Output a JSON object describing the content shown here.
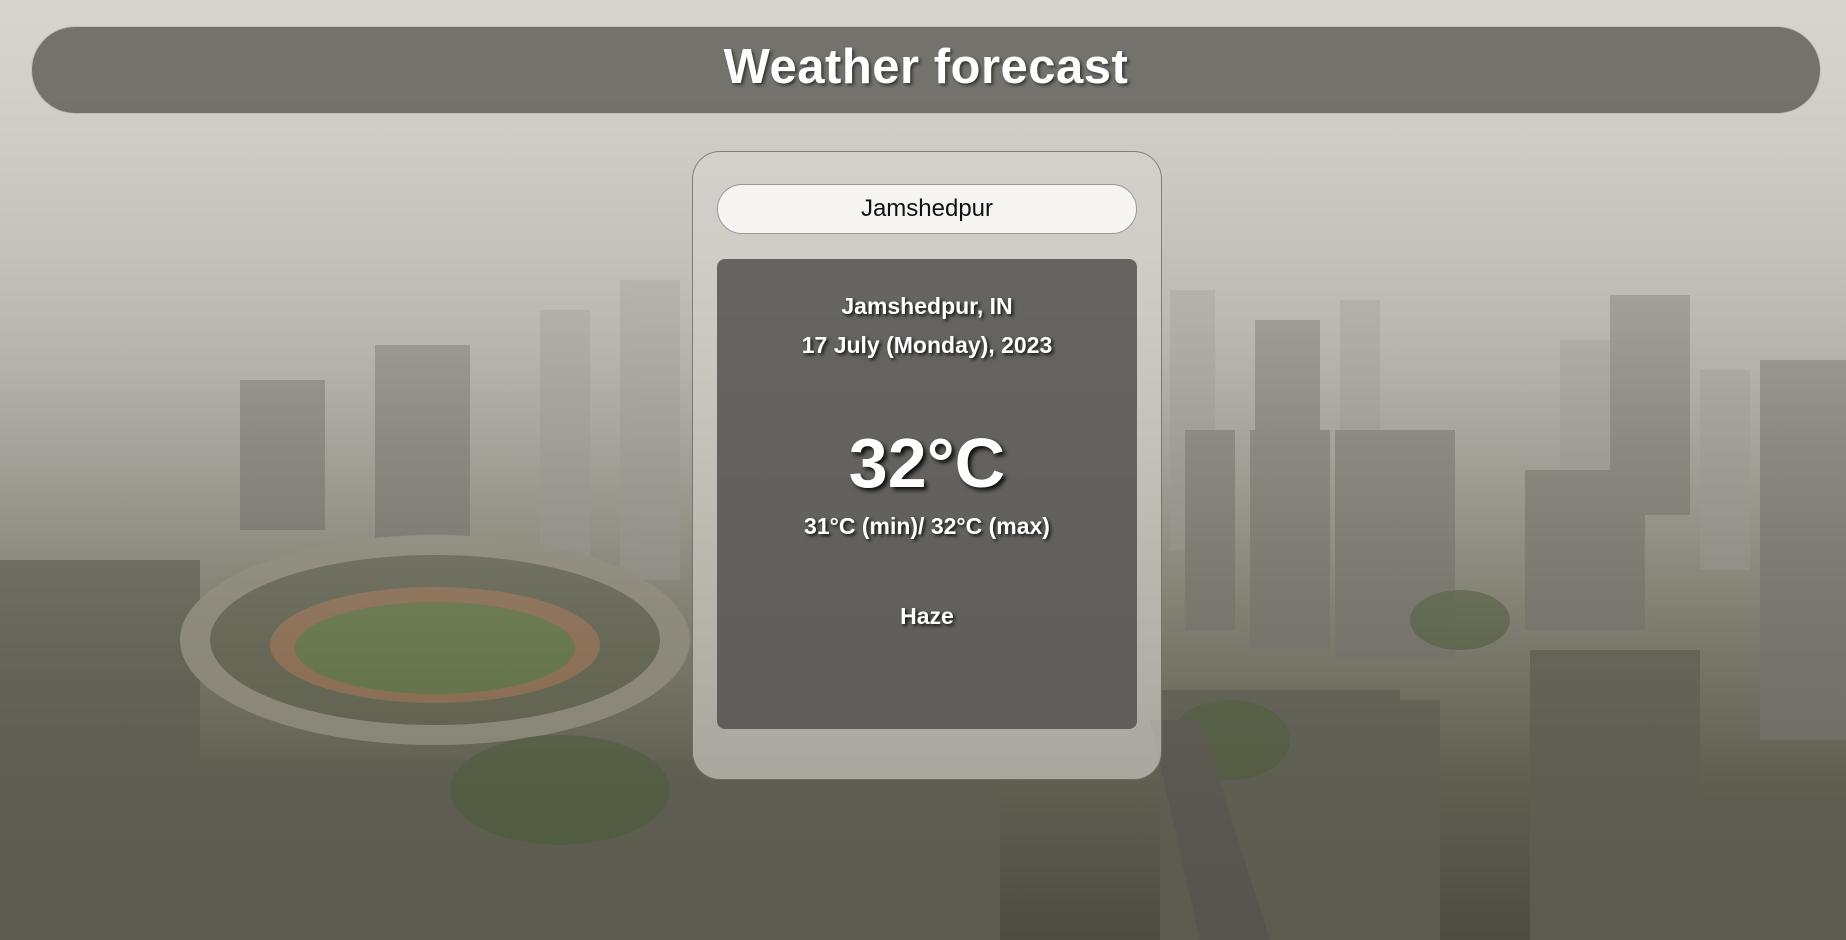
{
  "app": {
    "title": "Weather forecast"
  },
  "search": {
    "value": "Jamshedpur"
  },
  "weather": {
    "location": "Jamshedpur, IN",
    "date": "17 July (Monday), 2023",
    "temperature": "32°C",
    "min_max": "31°C (min)/ 32°C (max)",
    "condition": "Haze"
  },
  "colors": {
    "header_bg": "#5f5d58",
    "card_bg": "#d6d3cd",
    "panel_bg": "#4e4d4b",
    "text": "#ffffff"
  },
  "background": {
    "icon": "hazy-city-aerial-photo"
  }
}
